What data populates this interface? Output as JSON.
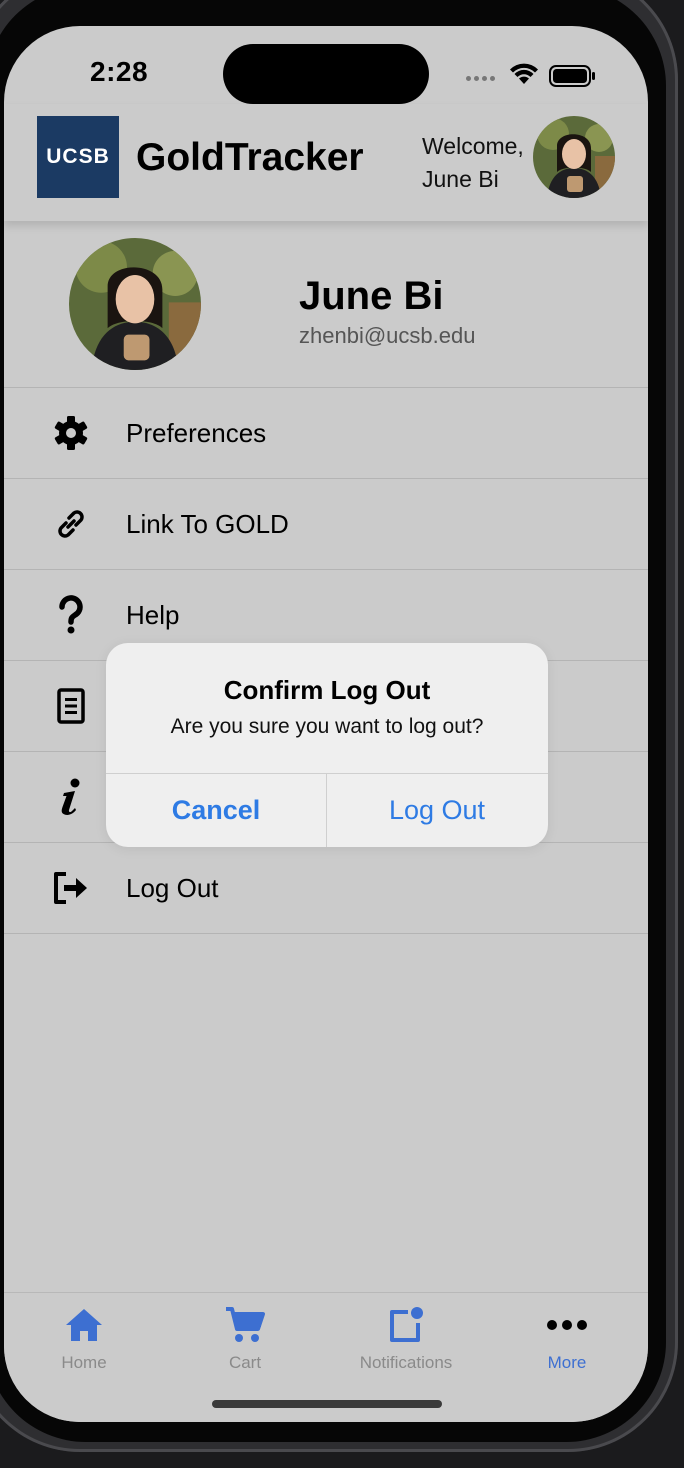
{
  "status_bar": {
    "time": "2:28"
  },
  "header": {
    "logo_text": "UCSB",
    "app_title": "GoldTracker",
    "welcome_line1": "Welcome,",
    "welcome_line2": "June Bi"
  },
  "profile": {
    "name": "June Bi",
    "email": "zhenbi@ucsb.edu"
  },
  "menu": {
    "items": [
      {
        "label": "Preferences",
        "icon": "gear-icon"
      },
      {
        "label": "Link To GOLD",
        "icon": "link-icon"
      },
      {
        "label": "Help",
        "icon": "question-icon"
      },
      {
        "label": "",
        "icon": "document-icon"
      },
      {
        "label": "",
        "icon": "info-icon"
      },
      {
        "label": "Log Out",
        "icon": "logout-icon"
      }
    ]
  },
  "alert": {
    "title": "Confirm Log Out",
    "message": "Are you sure you want to log out?",
    "cancel_label": "Cancel",
    "confirm_label": "Log Out"
  },
  "tab_bar": {
    "tabs": [
      {
        "label": "Home",
        "icon": "home-icon"
      },
      {
        "label": "Cart",
        "icon": "cart-icon"
      },
      {
        "label": "Notifications",
        "icon": "notification-icon"
      },
      {
        "label": "More",
        "icon": "more-icon"
      }
    ],
    "active": "More"
  },
  "colors": {
    "accent": "#3d6fd1",
    "alert_button": "#2e7be4",
    "ucsb_navy": "#1b3a63",
    "background": "#cbcbcb"
  }
}
